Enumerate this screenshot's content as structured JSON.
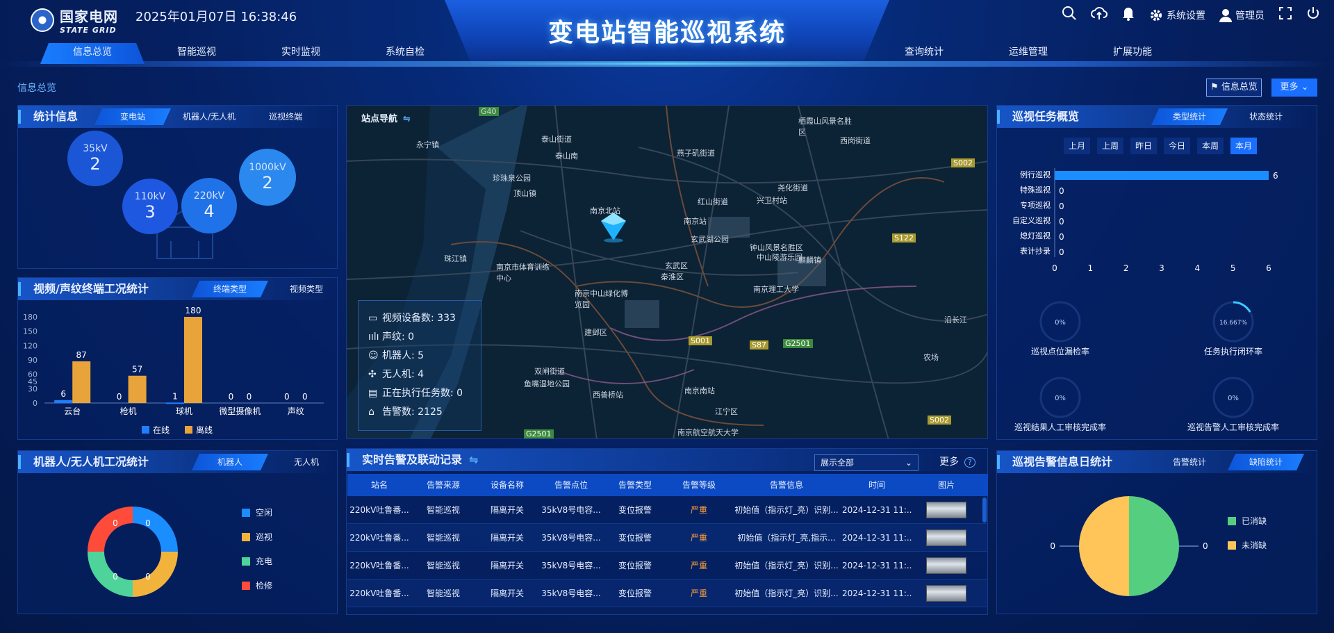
{
  "header": {
    "logo_cn": "国家电网",
    "logo_en": "STATE GRID",
    "datetime": "2025年01月07日 16:38:46",
    "title": "变电站智能巡视系统",
    "settings_label": "系统设置",
    "user_label": "管理员"
  },
  "nav_left": [
    {
      "label": "信息总览"
    },
    {
      "label": "智能巡视"
    },
    {
      "label": "实时监视"
    },
    {
      "label": "系统自检"
    }
  ],
  "nav_right": [
    {
      "label": "查询统计"
    },
    {
      "label": "运维管理"
    },
    {
      "label": "扩展功能"
    }
  ],
  "breadcrumb": "信息总览",
  "top_buttons": {
    "overview": "信息总览",
    "more": "更多"
  },
  "stats_panel": {
    "title": "统计信息",
    "tabs": [
      "变电站",
      "机器人/无人机",
      "巡视终端"
    ],
    "bubbles": [
      {
        "label": "35kV",
        "value": "2"
      },
      {
        "label": "110kV",
        "value": "3"
      },
      {
        "label": "220kV",
        "value": "4"
      },
      {
        "label": "1000kV",
        "value": "2"
      }
    ]
  },
  "video_panel": {
    "title": "视频/声纹终端工况统计",
    "tabs": [
      "终端类型",
      "视频类型"
    ]
  },
  "robot_panel": {
    "title": "机器人/无人机工况统计",
    "tabs": [
      "机器人",
      "无人机"
    ],
    "legend": [
      "空闲",
      "巡视",
      "充电",
      "检修"
    ],
    "labels": [
      "0",
      "0",
      "0",
      "0"
    ]
  },
  "map": {
    "nav_title": "站点导航",
    "info": [
      {
        "label": "视频设备数:",
        "value": "333"
      },
      {
        "label": "声纹:",
        "value": "0"
      },
      {
        "label": "机器人:",
        "value": "5"
      },
      {
        "label": "无人机:",
        "value": "4"
      },
      {
        "label": "正在执行任务数:",
        "value": "0"
      },
      {
        "label": "告警数:",
        "value": "2125"
      }
    ],
    "places": [
      "G40",
      "珠江镇",
      "永宁镇",
      "泰山街道",
      "泰山南",
      "珍珠泉公园",
      "顶山镇",
      "南京北站",
      "燕子矶街道",
      "红山街道",
      "兴卫村站",
      "尧化街道",
      "南京站",
      "玄武湖公园",
      "钟山风景名胜区",
      "中山陵游乐园",
      "南京理工大学",
      "玄武区",
      "秦淮区",
      "南京市体育训练中心",
      "南京中山绿化博览园",
      "建邺区",
      "双闸街道",
      "鱼嘴湿地公园",
      "西善桥站",
      "南京南站",
      "江宁区",
      "麒麟镇",
      "栖霞山风景名胜区",
      "西岗街道",
      "S002",
      "S122",
      "S001",
      "G2501",
      "S87",
      "G2501",
      "S002",
      "农场",
      "沿长江",
      "南京航空航天大学"
    ]
  },
  "alarm_panel": {
    "title": "实时告警及联动记录",
    "select": "展示全部",
    "more": "更多",
    "columns": [
      "站名",
      "告警来源",
      "设备名称",
      "告警点位",
      "告警类型",
      "告警等级",
      "告警信息",
      "时间",
      "图片"
    ],
    "rows": [
      [
        "220kV吐鲁番...",
        "智能巡视",
        "隔离开关",
        "35kV8号电容...",
        "变位报警",
        "严重",
        "初始值（指示灯_亮）识别...",
        "2024-12-31 11:..."
      ],
      [
        "220kV吐鲁番...",
        "智能巡视",
        "隔离开关",
        "35kV8号电容...",
        "变位报警",
        "严重",
        "初始值（指示灯_亮,指示...",
        "2024-12-31 11:..."
      ],
      [
        "220kV吐鲁番...",
        "智能巡视",
        "隔离开关",
        "35kV8号电容...",
        "变位报警",
        "严重",
        "初始值（指示灯_亮）识别...",
        "2024-12-31 11:..."
      ],
      [
        "220kV吐鲁番...",
        "智能巡视",
        "隔离开关",
        "35kV8号电容...",
        "变位报警",
        "严重",
        "初始值（指示灯_亮）识别...",
        "2024-12-31 11:..."
      ]
    ]
  },
  "task_panel": {
    "title": "巡视任务概览",
    "tabs": [
      "类型统计",
      "状态统计"
    ],
    "periods": [
      "上月",
      "上周",
      "昨日",
      "今日",
      "本周",
      "本月"
    ],
    "rings": [
      {
        "value": "0%",
        "label": "巡视点位漏检率",
        "fraction": 0
      },
      {
        "value": "16.667%",
        "label": "任务执行闭环率",
        "fraction": 0.16667
      },
      {
        "value": "0%",
        "label": "巡视结果人工审核完成率",
        "fraction": 0
      },
      {
        "value": "0%",
        "label": "巡视告警人工审核完成率",
        "fraction": 0
      }
    ]
  },
  "alarm_daily_panel": {
    "title": "巡视告警信息日统计",
    "tabs": [
      "告警统计",
      "缺陷统计"
    ],
    "legend": [
      "已消缺",
      "未消缺"
    ],
    "labels": [
      "0",
      "0"
    ]
  },
  "colors": {
    "online": "#1f7fff",
    "offline": "#e8a33a",
    "idle": "#1a8dff",
    "patrol": "#f2b33d",
    "charge": "#4ed49a",
    "repair": "#ff4b3a",
    "fixed": "#55cf7f",
    "unfixed": "#ffc559"
  },
  "chart_data": [
    {
      "type": "bar",
      "categories": [
        "云台",
        "枪机",
        "球机",
        "微型摄像机",
        "声纹"
      ],
      "series": [
        {
          "name": "在线",
          "values": [
            6,
            0,
            1,
            0,
            0
          ]
        },
        {
          "name": "离线",
          "values": [
            87,
            57,
            180,
            0,
            0
          ]
        }
      ],
      "ylim": [
        0,
        180
      ],
      "yticks": [
        0,
        30,
        45,
        60,
        90,
        120,
        150,
        180
      ]
    },
    {
      "type": "bar",
      "orientation": "horizontal",
      "categories": [
        "例行巡视",
        "特殊巡视",
        "专项巡视",
        "自定义巡视",
        "熄灯巡视",
        "表计抄录"
      ],
      "values": [
        6,
        0,
        0,
        0,
        0,
        0
      ],
      "xlim": [
        0,
        6
      ],
      "xticks": [
        0,
        1,
        2,
        3,
        4,
        5,
        6
      ]
    },
    {
      "type": "pie",
      "labels": [
        "空闲",
        "巡视",
        "充电",
        "检修"
      ],
      "values": [
        0,
        0,
        0,
        0
      ]
    },
    {
      "type": "pie",
      "labels": [
        "已消缺",
        "未消缺"
      ],
      "values": [
        0,
        0
      ]
    }
  ]
}
